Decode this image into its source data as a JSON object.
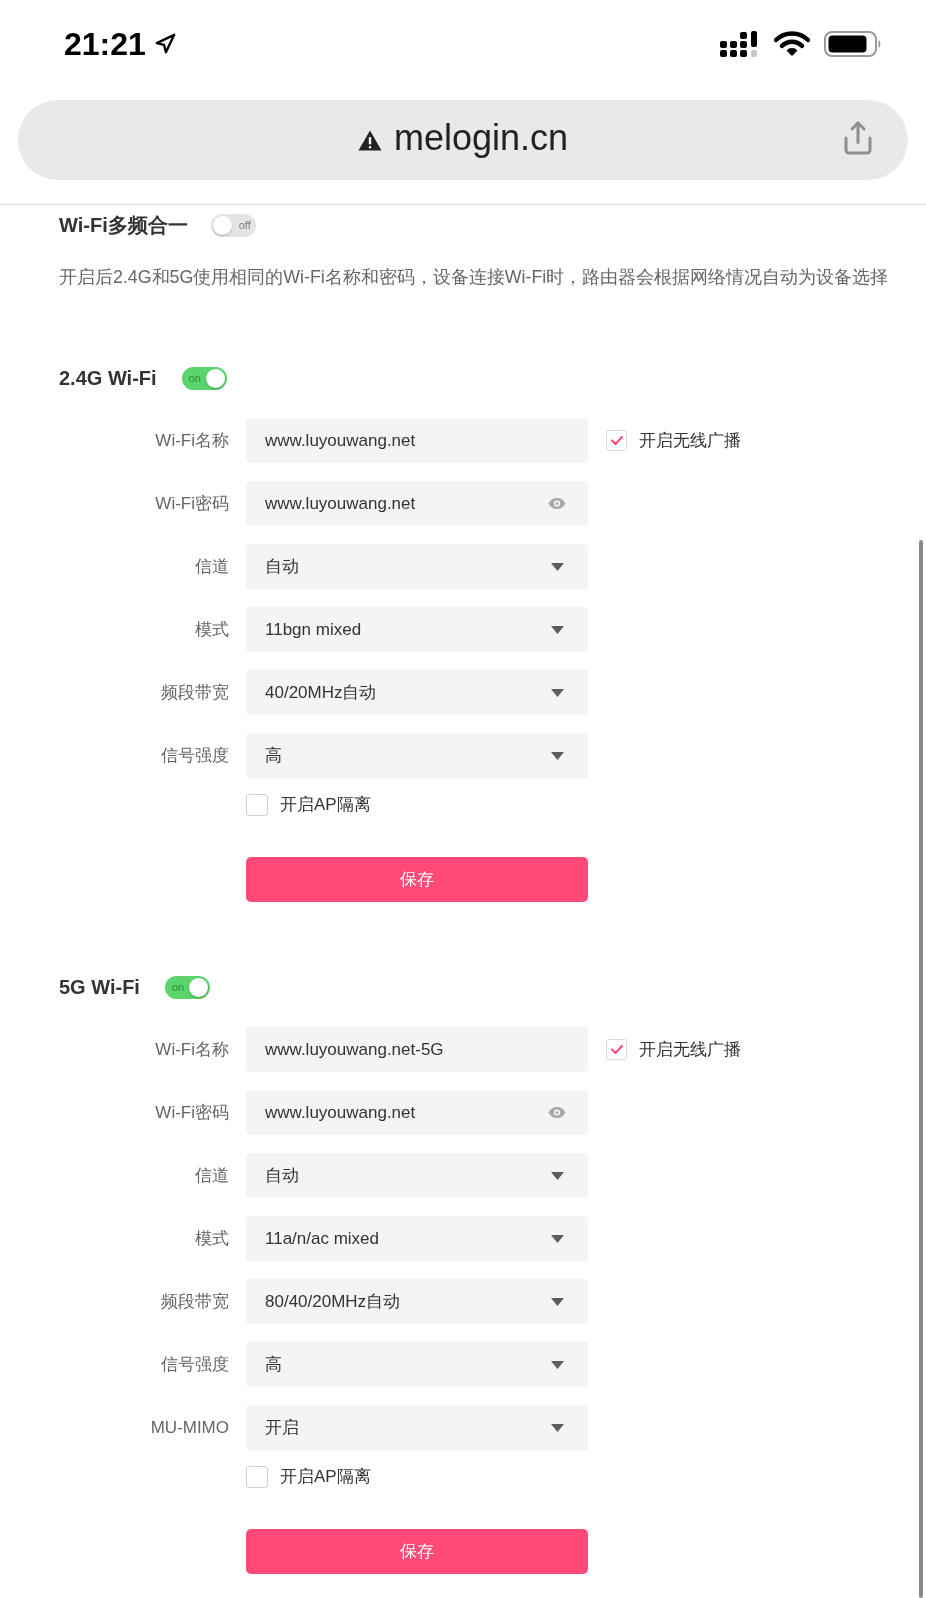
{
  "status_bar": {
    "time": "21:21"
  },
  "address_bar": {
    "url": "melogin.cn"
  },
  "band_merge": {
    "title": "Wi-Fi多频合一",
    "on": false,
    "toggle_label": "off",
    "description": "开启后2.4G和5G使用相同的Wi-Fi名称和密码，设备连接Wi-Fi时，路由器会根据网络情况自动为设备选择"
  },
  "sections": [
    {
      "title": "2.4G Wi-Fi",
      "on": true,
      "toggle_label": "on",
      "rows": [
        {
          "kind": "text",
          "label": "Wi-Fi名称",
          "value": "www.luyouwang.net",
          "checkbox": {
            "label": "开启无线广播",
            "checked": true
          }
        },
        {
          "kind": "password",
          "label": "Wi-Fi密码",
          "value": "www.luyouwang.net"
        },
        {
          "kind": "select",
          "label": "信道",
          "value": "自动"
        },
        {
          "kind": "select",
          "label": "模式",
          "value": "11bgn mixed"
        },
        {
          "kind": "select",
          "label": "频段带宽",
          "value": "40/20MHz自动"
        },
        {
          "kind": "select",
          "label": "信号强度",
          "value": "高"
        }
      ],
      "ap_isolation": {
        "label": "开启AP隔离",
        "checked": false
      },
      "save_button": "保存"
    },
    {
      "title": "5G Wi-Fi",
      "on": true,
      "toggle_label": "on",
      "rows": [
        {
          "kind": "text",
          "label": "Wi-Fi名称",
          "value": "www.luyouwang.net-5G",
          "checkbox": {
            "label": "开启无线广播",
            "checked": true
          }
        },
        {
          "kind": "password",
          "label": "Wi-Fi密码",
          "value": "www.luyouwang.net"
        },
        {
          "kind": "select",
          "label": "信道",
          "value": "自动"
        },
        {
          "kind": "select",
          "label": "模式",
          "value": "11a/n/ac mixed"
        },
        {
          "kind": "select",
          "label": "频段带宽",
          "value": "80/40/20MHz自动"
        },
        {
          "kind": "select",
          "label": "信号强度",
          "value": "高"
        },
        {
          "kind": "select",
          "label": "MU-MIMO",
          "value": "开启"
        }
      ],
      "ap_isolation": {
        "label": "开启AP隔离",
        "checked": false
      },
      "save_button": "保存"
    }
  ]
}
